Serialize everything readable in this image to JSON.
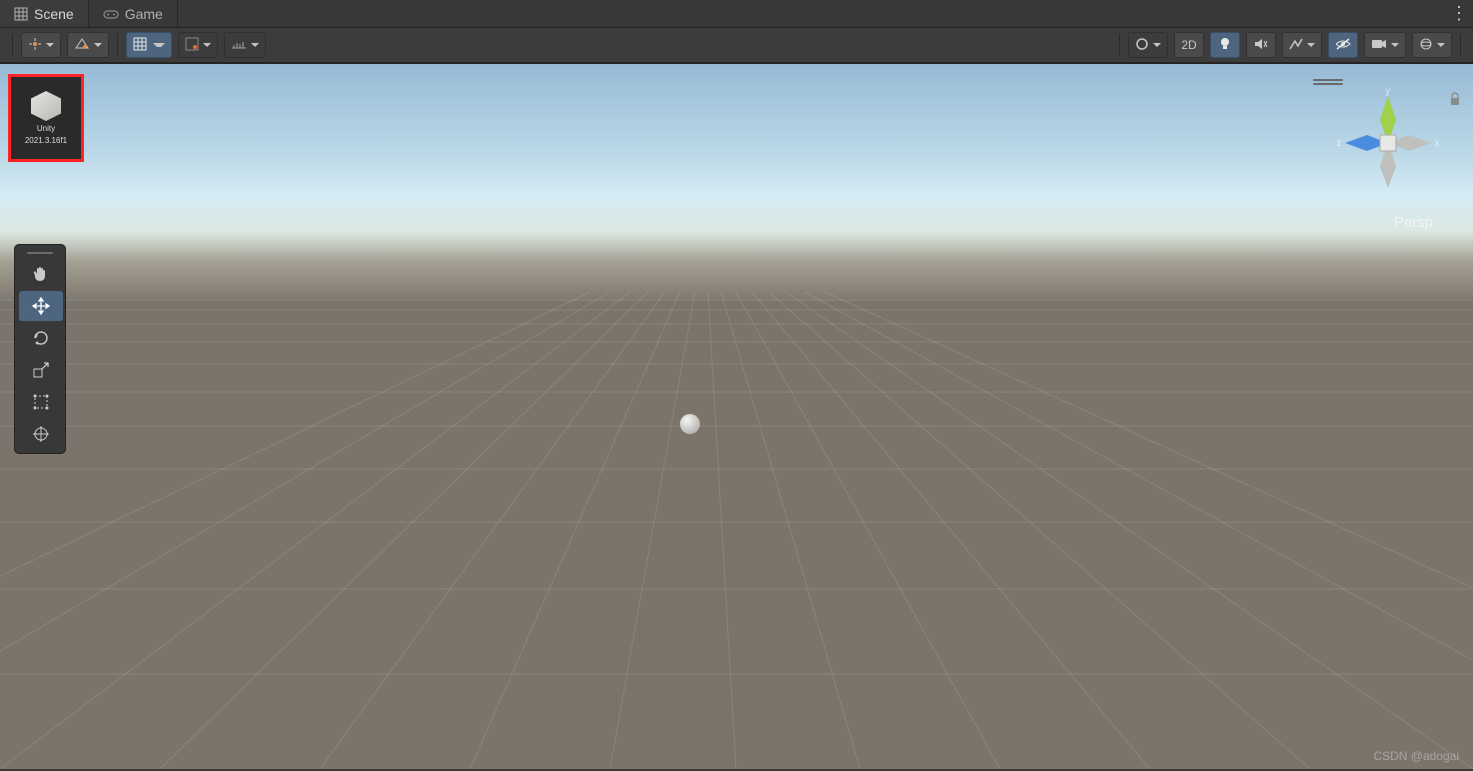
{
  "tabs": {
    "scene": "Scene",
    "game": "Game"
  },
  "toolbar": {
    "btn_2d": "2D"
  },
  "thumbnail": {
    "title": "Unity",
    "version": "2021.3.16f1"
  },
  "viewport": {
    "perspective_label": "Persp",
    "axes": {
      "x": "x",
      "y": "y",
      "z": "z"
    }
  },
  "watermark": "CSDN @adogai",
  "icons": {
    "scene": "grid-icon",
    "game": "gamepad-icon",
    "menu": "vertical-dots-icon",
    "pivot": "pivot-center-icon",
    "handle": "local-global-icon",
    "gridsnap": "grid-snap-icon",
    "snap_inc": "snap-increment-icon",
    "snap_axis": "snap-axis-icon",
    "shading": "circle-icon",
    "light": "lightbulb-icon",
    "audio": "audio-mute-icon",
    "fx": "fx-icon",
    "eyeoff": "eye-off-icon",
    "camera": "camera-icon",
    "gizmos": "gizmos-icon",
    "hand": "hand-icon",
    "move": "move-icon",
    "rotate": "rotate-icon",
    "scale": "scale-icon",
    "rect": "rect-icon",
    "transform": "transform-icon",
    "lock": "lock-icon"
  }
}
